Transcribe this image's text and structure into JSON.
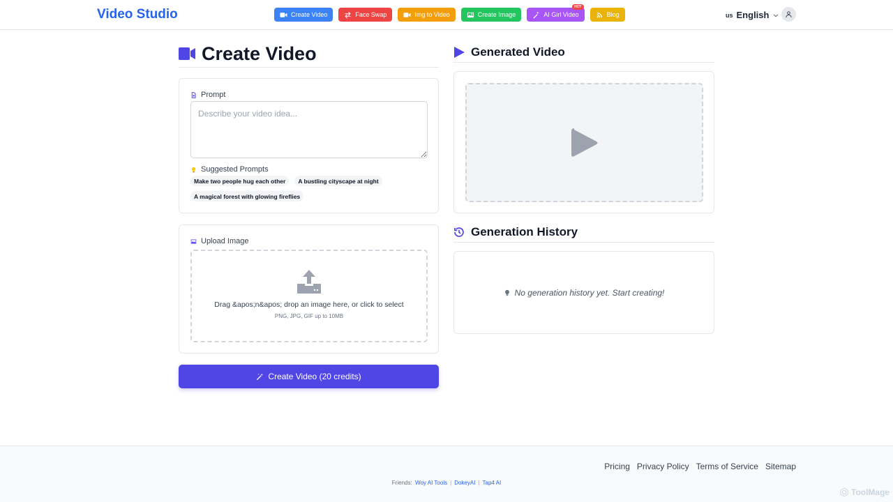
{
  "header": {
    "brand": "Video Studio",
    "nav": [
      {
        "label": "Create Video",
        "icon": "video-camera-icon",
        "color": "#3b82f6"
      },
      {
        "label": "Face Swap",
        "icon": "swap-arrows-icon",
        "color": "#ef4444"
      },
      {
        "label": "Img to Video",
        "icon": "video-camera-icon",
        "color": "#f59e0b"
      },
      {
        "label": "Create Image",
        "icon": "image-icon",
        "color": "#22c55e"
      },
      {
        "label": "AI Girl Video",
        "icon": "sparkle-wand-icon",
        "color": "#a855f7",
        "badge": "HOT"
      },
      {
        "label": "Blog",
        "icon": "blog-icon",
        "color": "#eab308"
      }
    ],
    "language": {
      "flag": "us",
      "label": "English"
    },
    "user_icon": "user-icon"
  },
  "left": {
    "title": "Create Video",
    "prompt": {
      "label": "Prompt",
      "placeholder": "Describe your video idea...",
      "value": "",
      "suggested_label": "Suggested Prompts",
      "suggestions": [
        "Make two people hug each other",
        "A bustling cityscape at night",
        "A magical forest with glowing fireflies"
      ]
    },
    "upload": {
      "label": "Upload Image",
      "instruction": "Drag &apos;n&apos; drop an image here, or click to select",
      "formats": "PNG, JPG, GIF up to 10MB"
    },
    "create_button": "Create Video (20 credits)"
  },
  "right": {
    "generated_title": "Generated Video",
    "history_title": "Generation History",
    "history_empty": "No generation history yet. Start creating!"
  },
  "footer": {
    "links": [
      "Pricing",
      "Privacy Policy",
      "Terms of Service",
      "Sitemap"
    ],
    "friends_label": "Friends:",
    "friends": [
      "Woy AI Tools",
      "DokeyAI",
      "Tap4 AI"
    ],
    "watermark": "ToolMage"
  },
  "colors": {
    "brand": "#2563eb",
    "accent": "#4f46e5"
  }
}
